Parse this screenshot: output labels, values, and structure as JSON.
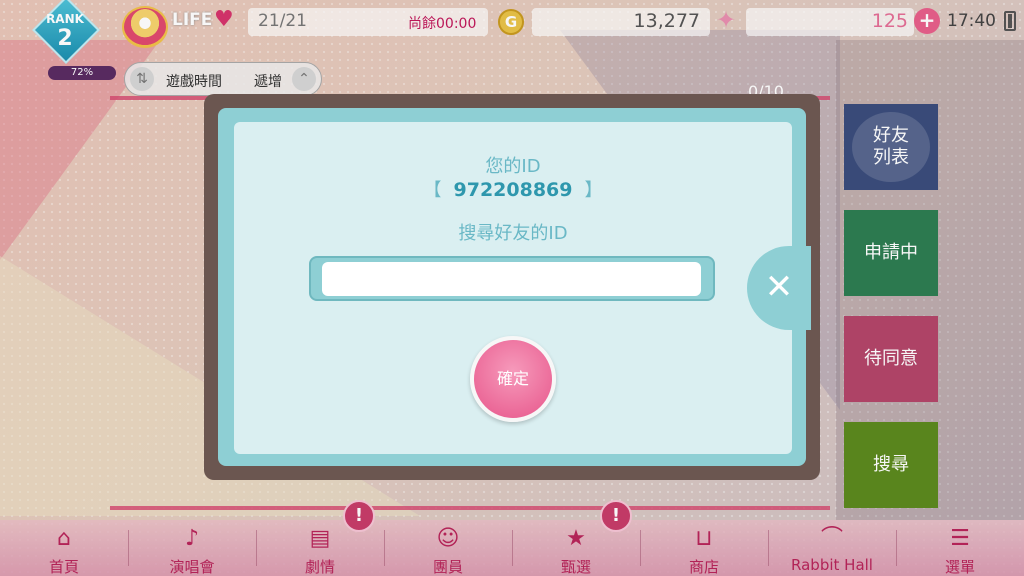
{
  "status": {
    "rank_label": "RANK",
    "rank_value": "2",
    "rank_progress": "72%",
    "life_label": "LIFE",
    "life_count": "21/21",
    "life_remaining": "尚餘00:00",
    "coin_symbol": "G",
    "coins": "13,277",
    "gems": "125",
    "time": "17:40"
  },
  "sort": {
    "key": "遊戲時間",
    "order": "遞增"
  },
  "friend_count": "0/10",
  "side_buttons": {
    "list": "好友\n列表",
    "pending": "申請中",
    "awaiting": "待同意",
    "search": "搜尋"
  },
  "modal": {
    "your_id_label": "您的ID",
    "bracket_open": "【",
    "your_id": "972208869",
    "bracket_close": "】",
    "search_label": "搜尋好友的ID",
    "input_value": "",
    "input_placeholder": "",
    "confirm": "確定",
    "close_symbol": "✕"
  },
  "nav": [
    {
      "label": "首頁",
      "icon": "home-icon",
      "glyph": "⌂"
    },
    {
      "label": "演唱會",
      "icon": "music-note-icon",
      "glyph": "♪"
    },
    {
      "label": "劇情",
      "icon": "book-icon",
      "glyph": "▤"
    },
    {
      "label": "團員",
      "icon": "member-icon",
      "glyph": "☺"
    },
    {
      "label": "甄選",
      "icon": "star-card-icon",
      "glyph": "★"
    },
    {
      "label": "商店",
      "icon": "basket-icon",
      "glyph": "⊔"
    },
    {
      "label": "Rabbit Hall",
      "icon": "hall-icon",
      "glyph": "⌒"
    },
    {
      "label": "選單",
      "icon": "menu-icon",
      "glyph": "☰"
    }
  ],
  "alert_symbol": "!",
  "colors": {
    "modal_teal": "#8ecfd4",
    "modal_inner": "#daeff1",
    "confirm_pink": "#e7558a",
    "nav_text": "#b8255a"
  }
}
